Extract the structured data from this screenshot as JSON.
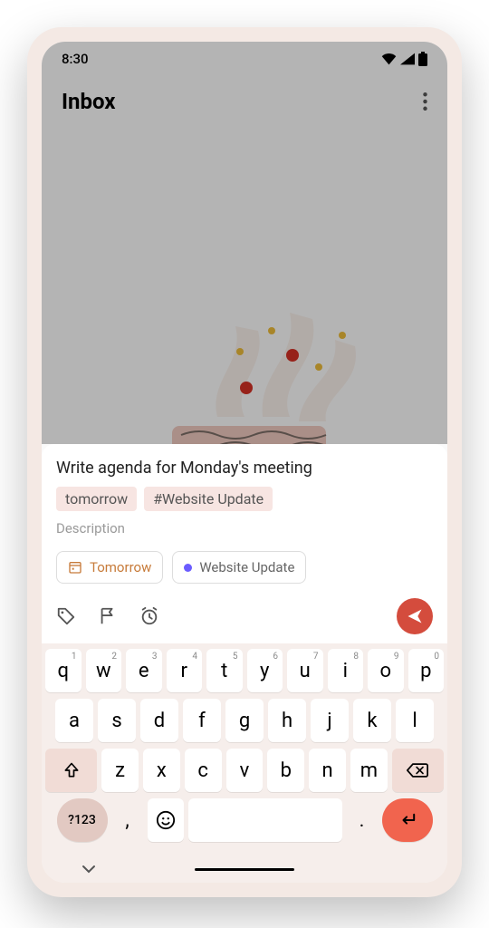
{
  "status": {
    "time": "8:30"
  },
  "header": {
    "title": "Inbox"
  },
  "task": {
    "title": "Write agenda for Monday's meeting",
    "chips": [
      "tomorrow",
      "#Website Update"
    ],
    "description_placeholder": "Description",
    "options": {
      "date_label": "Tomorrow",
      "project_label": "Website Update"
    }
  },
  "keyboard": {
    "row1": [
      "q",
      "w",
      "e",
      "r",
      "t",
      "y",
      "u",
      "i",
      "o",
      "p"
    ],
    "row1_nums": [
      "1",
      "2",
      "3",
      "4",
      "5",
      "6",
      "7",
      "8",
      "9",
      "0"
    ],
    "row2": [
      "a",
      "s",
      "d",
      "f",
      "g",
      "h",
      "j",
      "k",
      "l"
    ],
    "row3": [
      "z",
      "x",
      "c",
      "v",
      "b",
      "n",
      "m"
    ],
    "symbols_key": "?123",
    "comma": ",",
    "period": "."
  }
}
